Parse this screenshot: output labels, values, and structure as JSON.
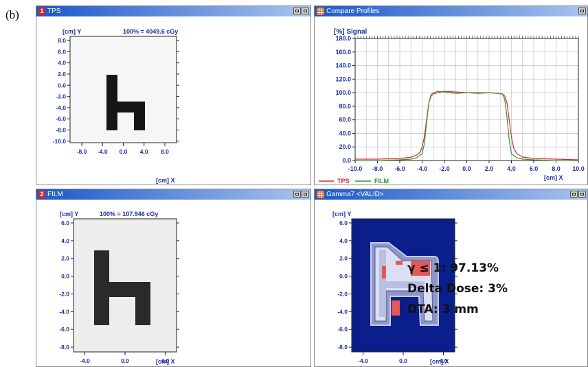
{
  "figure_label": "(b)",
  "windows": {
    "tps": {
      "number": "1",
      "title": "TPS",
      "norm": "100% = 4049.6 cGy",
      "axis_y": "[cm] Y",
      "axis_x": "[cm] X",
      "y_ticks": [
        "8.0",
        "6.0",
        "4.0",
        "2.0",
        "0.0",
        "-2.0",
        "-4.0",
        "-6.0",
        "-8.0",
        "-10.0"
      ],
      "x_ticks": [
        "-8.0",
        "-4.0",
        "0.0",
        "4.0",
        "8.0"
      ]
    },
    "compare": {
      "title": "Compare Profiles",
      "icon": "profile-grid-icon"
    },
    "film": {
      "number": "2",
      "title": "FILM",
      "norm": "100% = 107.946 cGy",
      "axis_y": "[cm] Y",
      "axis_x": "[cm] X",
      "y_ticks": [
        "6.0",
        "4.0",
        "2.0",
        "0.0",
        "-2.0",
        "-4.0",
        "-6.0",
        "-8.0"
      ],
      "x_ticks": [
        "-4.0",
        "0.0",
        "4.0"
      ]
    },
    "gamma": {
      "title": "Gamma7 <VALID>",
      "icon": "gamma-grid-icon",
      "axis_y": "[cm] Y",
      "axis_x": "[cm] X",
      "y_ticks": [
        "6.0",
        "4.0",
        "2.0",
        "0.0",
        "-2.0",
        "-4.0",
        "-6.0",
        "-8.0"
      ],
      "x_ticks": [
        "-4.0",
        "0.0",
        "4.0"
      ]
    }
  },
  "annotations": {
    "gamma_pass": "γ ≤ 1: 97.13%",
    "delta_dose": "Delta Dose: 3%",
    "dta": "DTA: 3 mm"
  },
  "colors": {
    "title_gradient_start": "#1c57c8",
    "title_gradient_end": "#a9c4ee",
    "axis_text": "#1a2fa0",
    "tps_series": "#e0262a",
    "film_series": "#2a9a2a",
    "gamma_background": "#0b1f8c"
  },
  "chart_data": {
    "type": "line",
    "ylabel": "[%] Signal",
    "xlabel": "[cm] X",
    "xlim": [
      -10.0,
      10.0
    ],
    "ylim": [
      0,
      180
    ],
    "grid": true,
    "legend": "bottom-left",
    "x_ticks": [
      "-10.0",
      "-8.0",
      "-6.0",
      "-4.0",
      "-2.0",
      "0.0",
      "2.0",
      "4.0",
      "6.0",
      "8.0",
      "10.0"
    ],
    "y_ticks": [
      "180.0",
      "160.0",
      "140.0",
      "120.0",
      "100.0",
      "80.0",
      "60.0",
      "40.0",
      "20.0",
      "0.0"
    ],
    "series": [
      {
        "name": "TPS",
        "color": "#e0262a",
        "x": [
          -10,
          -8,
          -6,
          -5,
          -4.5,
          -4.2,
          -4.0,
          -3.8,
          -3.6,
          -3.4,
          -3.2,
          -3.0,
          -2.6,
          -2.0,
          0,
          2.0,
          2.8,
          3.2,
          3.4,
          3.6,
          3.8,
          4.0,
          4.2,
          4.5,
          5,
          6,
          8,
          10
        ],
        "y": [
          2,
          2,
          3,
          5,
          8,
          12,
          20,
          35,
          60,
          85,
          95,
          98,
          100,
          102,
          100,
          100,
          99,
          98,
          95,
          85,
          60,
          35,
          18,
          10,
          5,
          3,
          2,
          1
        ]
      },
      {
        "name": "FILM",
        "color": "#2a9a2a",
        "x": [
          -10,
          -8,
          -6,
          -5,
          -4.5,
          -4.0,
          -3.8,
          -3.6,
          -3.4,
          -3.2,
          -3.0,
          -2.6,
          -2.0,
          -1.0,
          0,
          1.0,
          2.0,
          2.8,
          3.2,
          3.4,
          3.6,
          3.8,
          4.0,
          4.5,
          5,
          6,
          8,
          10
        ],
        "y": [
          0,
          0,
          1,
          2,
          4,
          10,
          25,
          55,
          85,
          97,
          100,
          102,
          101,
          99,
          100,
          99,
          100,
          99,
          98,
          90,
          65,
          30,
          10,
          4,
          2,
          1,
          0,
          0
        ]
      }
    ]
  }
}
